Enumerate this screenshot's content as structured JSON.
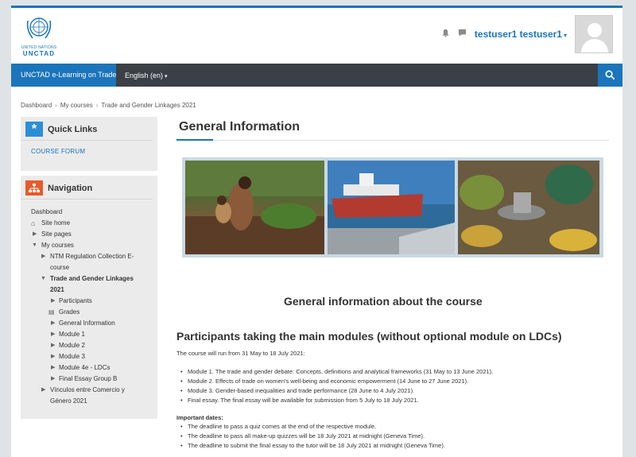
{
  "header": {
    "logo_line1": "UNITED NATIONS",
    "logo_line2": "UNCTAD",
    "username": "testuser1 testuser1",
    "icons": [
      "bell-icon",
      "chat-icon"
    ]
  },
  "navbar": {
    "brand": "UNCTAD e-Learning on Trade",
    "language": "English (en)"
  },
  "breadcrumb": [
    "Dashboard",
    "My courses",
    "Trade and Gender Linkages 2021"
  ],
  "quick_links": {
    "title": "Quick Links",
    "link": "COURSE FORUM"
  },
  "navigation": {
    "title": "Navigation",
    "items": {
      "dashboard": "Dashboard",
      "site_home": "Site home",
      "site_pages": "Site pages",
      "my_courses": "My courses",
      "ntm_1": "NTM Regulation Collection E-",
      "ntm_2": "course",
      "tgl_1": "Trade and Gender Linkages",
      "tgl_2": "2021",
      "participants": "Participants",
      "grades": "Grades",
      "general_info": "General Information",
      "module1": "Module 1",
      "module2": "Module 2",
      "module3": "Module 3",
      "module4e": "Module 4e - LDCs",
      "final_essay": "Final Essay Group B",
      "vinculos_1": "Vínculos entre Comercio y",
      "vinculos_2": "Género 2021"
    }
  },
  "main": {
    "title": "General Information",
    "h2": "General information about the course",
    "h3": "Participants taking the main modules (without optional module on LDCs)",
    "intro": "The course will run from 31 May to 18 July 2021:",
    "modules": [
      "Module 1. The trade and gender debate: Concepts, definitions and analytical frameworks (31 May to 13 June 2021).",
      "Module 2. Effects of trade on women's well-being and economic empowerment (14 June to 27 June 2021).",
      "Module 3. Gender-based inequalities and trade performance (28 June to 4 July 2021).",
      "Final essay. The final essay will be available for submission from 5 July to 18 July 2021."
    ],
    "important_label": "Important dates:",
    "dates": [
      "The deadline to pass a quiz comes at the end of the respective module.",
      "The deadline to pass all make-up quizzes will be 18 July 2021 at midnight (Geneva Time).",
      "The deadline to submit the final essay to the tutor will be 18 July 2021 at midnight (Geneva Time)."
    ]
  },
  "colors": {
    "accent": "#1b75bb",
    "navbar": "#3a4045",
    "quick_links_icon": "#2c8fd6",
    "navigation_icon": "#e85a2a"
  }
}
